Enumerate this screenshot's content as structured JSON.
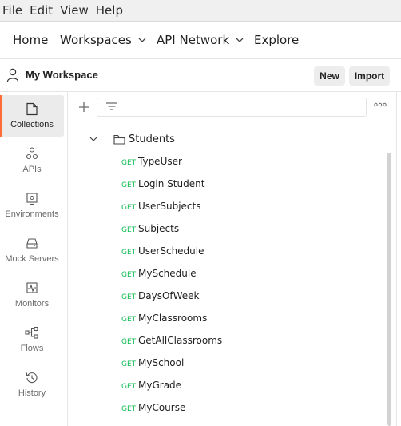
{
  "menubar": {
    "items": [
      "File",
      "Edit",
      "View",
      "Help"
    ]
  },
  "topnav": {
    "home": "Home",
    "workspaces": "Workspaces",
    "api_network": "API Network",
    "explore": "Explore"
  },
  "workspace": {
    "name": "My Workspace",
    "new_label": "New",
    "import_label": "Import"
  },
  "sidebar": {
    "items": [
      {
        "label": "Collections",
        "icon": "collections-icon",
        "active": true
      },
      {
        "label": "APIs",
        "icon": "apis-icon"
      },
      {
        "label": "Environments",
        "icon": "environments-icon"
      },
      {
        "label": "Mock Servers",
        "icon": "mock-servers-icon"
      },
      {
        "label": "Monitors",
        "icon": "monitors-icon"
      },
      {
        "label": "Flows",
        "icon": "flows-icon"
      },
      {
        "label": "History",
        "icon": "history-icon"
      }
    ]
  },
  "collection": {
    "name": "Students",
    "requests": [
      {
        "method": "GET",
        "name": "TypeUser"
      },
      {
        "method": "GET",
        "name": "Login Student"
      },
      {
        "method": "GET",
        "name": "UserSubjects"
      },
      {
        "method": "GET",
        "name": "Subjects"
      },
      {
        "method": "GET",
        "name": "UserSchedule"
      },
      {
        "method": "GET",
        "name": "MySchedule"
      },
      {
        "method": "GET",
        "name": "DaysOfWeek"
      },
      {
        "method": "GET",
        "name": "MyClassrooms"
      },
      {
        "method": "GET",
        "name": "GetAllClassrooms"
      },
      {
        "method": "GET",
        "name": "MySchool"
      },
      {
        "method": "GET",
        "name": "MyGrade"
      },
      {
        "method": "GET",
        "name": "MyCourse"
      }
    ]
  },
  "colors": {
    "accent": "#ff6c37",
    "get_method": "#0cbb52"
  }
}
